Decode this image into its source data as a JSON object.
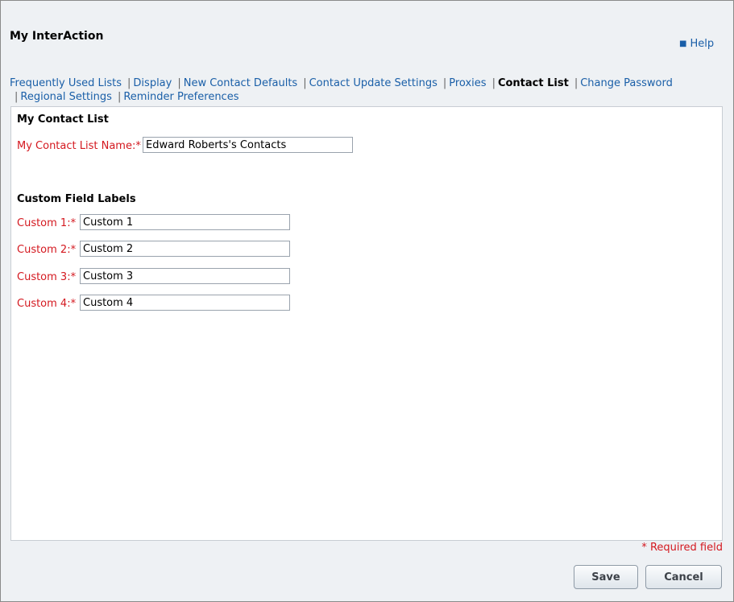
{
  "window": {
    "title": "My InterAction"
  },
  "help": {
    "label": "Help"
  },
  "tabs": [
    {
      "label": "Frequently Used Lists",
      "active": false
    },
    {
      "label": "Display",
      "active": false
    },
    {
      "label": "New Contact Defaults",
      "active": false
    },
    {
      "label": "Contact Update Settings",
      "active": false
    },
    {
      "label": "Proxies",
      "active": false
    },
    {
      "label": "Contact List",
      "active": true
    },
    {
      "label": "Change Password",
      "active": false
    },
    {
      "label": "Regional Settings",
      "active": false
    },
    {
      "label": "Reminder Preferences",
      "active": false
    }
  ],
  "separator": "|",
  "contact_list": {
    "section_title": "My Contact List",
    "name_label": "My Contact List Name:*",
    "name_value": "Edward Roberts's Contacts"
  },
  "custom_fields": {
    "section_title": "Custom Field Labels",
    "fields": [
      {
        "label": "Custom 1:*",
        "value": "Custom 1"
      },
      {
        "label": "Custom 2:*",
        "value": "Custom 2"
      },
      {
        "label": "Custom 3:*",
        "value": "Custom 3"
      },
      {
        "label": "Custom 4:*",
        "value": "Custom 4"
      }
    ]
  },
  "footer": {
    "required_note": "* Required field",
    "save_label": "Save",
    "cancel_label": "Cancel"
  },
  "colors": {
    "link": "#1a5fa8",
    "required": "#d4181f",
    "background": "#eef1f4"
  }
}
